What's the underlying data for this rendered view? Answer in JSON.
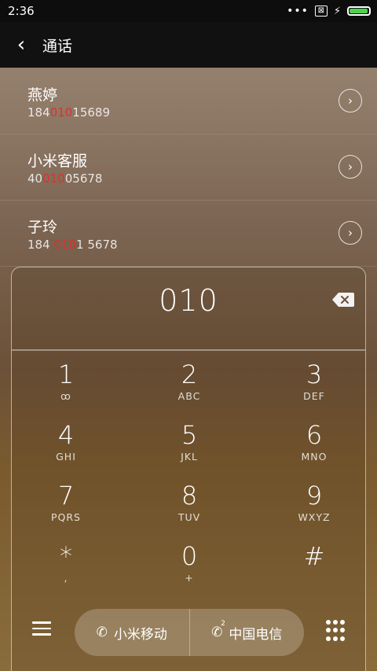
{
  "status": {
    "time": "2:36",
    "dots": "•••",
    "sim_icon": "⊠",
    "bolt": "⚡",
    "battery_level": 0.95
  },
  "header": {
    "back_icon": "‹",
    "title": "通话"
  },
  "contacts": [
    {
      "name": "燕婷",
      "number_pre": "184",
      "number_match": "010",
      "number_post": "15689"
    },
    {
      "name": "小米客服",
      "number_pre": "40",
      "number_match": "010",
      "number_post": "05678"
    },
    {
      "name": "子玲",
      "number_pre": "184 ",
      "number_match": "010",
      "number_post": "1 5678"
    }
  ],
  "dialer": {
    "input": "010",
    "keys": [
      {
        "digit": "1",
        "letters": "ꝏ"
      },
      {
        "digit": "2",
        "letters": "ABC"
      },
      {
        "digit": "3",
        "letters": "DEF"
      },
      {
        "digit": "4",
        "letters": "GHI"
      },
      {
        "digit": "5",
        "letters": "JKL"
      },
      {
        "digit": "6",
        "letters": "MNO"
      },
      {
        "digit": "7",
        "letters": "PQRS"
      },
      {
        "digit": "8",
        "letters": "TUV"
      },
      {
        "digit": "9",
        "letters": "WXYZ"
      },
      {
        "digit": "*",
        "letters": ","
      },
      {
        "digit": "0",
        "letters": "+"
      },
      {
        "digit": "#",
        "letters": ""
      }
    ],
    "sim1_label": "小米移动",
    "sim2_label": "中国电信",
    "phone_icon": "✆",
    "sim2_sup": "2"
  }
}
